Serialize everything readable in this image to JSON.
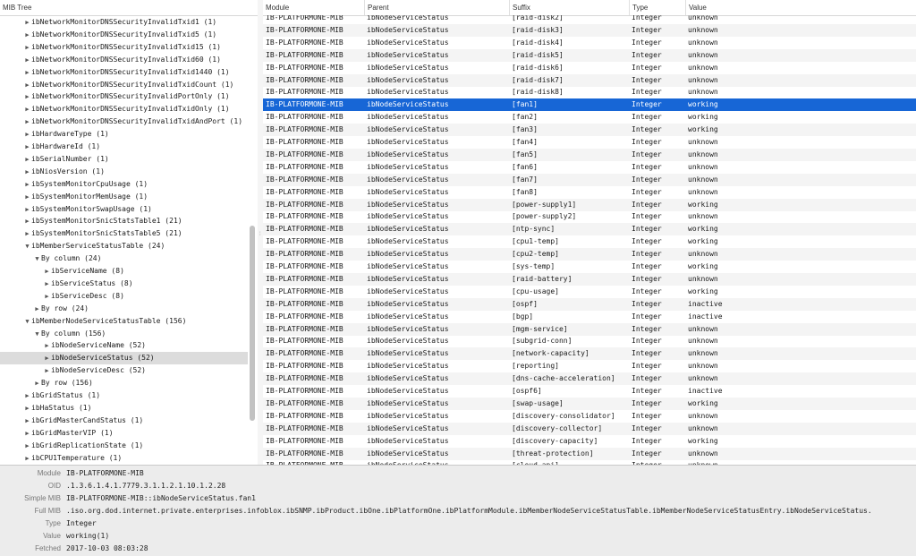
{
  "tree": {
    "header": "MIB Tree",
    "rows": [
      {
        "label": "ibNetworkMonitorDNSSecurityInvalidTxid1 (1)",
        "level": 2,
        "toggle": "collapsed"
      },
      {
        "label": "ibNetworkMonitorDNSSecurityInvalidTxid5 (1)",
        "level": 2,
        "toggle": "collapsed"
      },
      {
        "label": "ibNetworkMonitorDNSSecurityInvalidTxid15 (1)",
        "level": 2,
        "toggle": "collapsed"
      },
      {
        "label": "ibNetworkMonitorDNSSecurityInvalidTxid60 (1)",
        "level": 2,
        "toggle": "collapsed"
      },
      {
        "label": "ibNetworkMonitorDNSSecurityInvalidTxid1440 (1)",
        "level": 2,
        "toggle": "collapsed"
      },
      {
        "label": "ibNetworkMonitorDNSSecurityInvalidTxidCount (1)",
        "level": 2,
        "toggle": "collapsed"
      },
      {
        "label": "ibNetworkMonitorDNSSecurityInvalidPortOnly (1)",
        "level": 2,
        "toggle": "collapsed"
      },
      {
        "label": "ibNetworkMonitorDNSSecurityInvalidTxidOnly (1)",
        "level": 2,
        "toggle": "collapsed"
      },
      {
        "label": "ibNetworkMonitorDNSSecurityInvalidTxidAndPort (1)",
        "level": 2,
        "toggle": "collapsed"
      },
      {
        "label": "ibHardwareType (1)",
        "level": 2,
        "toggle": "collapsed"
      },
      {
        "label": "ibHardwareId (1)",
        "level": 2,
        "toggle": "collapsed"
      },
      {
        "label": "ibSerialNumber (1)",
        "level": 2,
        "toggle": "collapsed"
      },
      {
        "label": "ibNiosVersion (1)",
        "level": 2,
        "toggle": "collapsed"
      },
      {
        "label": "ibSystemMonitorCpuUsage (1)",
        "level": 2,
        "toggle": "collapsed"
      },
      {
        "label": "ibSystemMonitorMemUsage (1)",
        "level": 2,
        "toggle": "collapsed"
      },
      {
        "label": "ibSystemMonitorSwapUsage (1)",
        "level": 2,
        "toggle": "collapsed"
      },
      {
        "label": "ibSystemMonitorSnicStatsTable1 (21)",
        "level": 2,
        "toggle": "collapsed"
      },
      {
        "label": "ibSystemMonitorSnicStatsTable5 (21)",
        "level": 2,
        "toggle": "collapsed"
      },
      {
        "label": "ibMemberServiceStatusTable (24)",
        "level": 2,
        "toggle": "expanded"
      },
      {
        "label": "By column (24)",
        "level": 3,
        "toggle": "expanded"
      },
      {
        "label": "ibServiceName (8)",
        "level": 4,
        "toggle": "collapsed"
      },
      {
        "label": "ibServiceStatus (8)",
        "level": 4,
        "toggle": "collapsed"
      },
      {
        "label": "ibServiceDesc (8)",
        "level": 4,
        "toggle": "collapsed"
      },
      {
        "label": "By row (24)",
        "level": 3,
        "toggle": "collapsed"
      },
      {
        "label": "ibMemberNodeServiceStatusTable (156)",
        "level": 2,
        "toggle": "expanded"
      },
      {
        "label": "By column (156)",
        "level": 3,
        "toggle": "expanded"
      },
      {
        "label": "ibNodeServiceName (52)",
        "level": 4,
        "toggle": "collapsed"
      },
      {
        "label": "ibNodeServiceStatus (52)",
        "level": 4,
        "toggle": "collapsed",
        "selected": true
      },
      {
        "label": "ibNodeServiceDesc (52)",
        "level": 4,
        "toggle": "collapsed"
      },
      {
        "label": "By row (156)",
        "level": 3,
        "toggle": "collapsed"
      },
      {
        "label": "ibGridStatus (1)",
        "level": 2,
        "toggle": "collapsed"
      },
      {
        "label": "ibHaStatus (1)",
        "level": 2,
        "toggle": "collapsed"
      },
      {
        "label": "ibGridMasterCandStatus (1)",
        "level": 2,
        "toggle": "collapsed"
      },
      {
        "label": "ibGridMasterVIP (1)",
        "level": 2,
        "toggle": "collapsed"
      },
      {
        "label": "ibGridReplicationState (1)",
        "level": 2,
        "toggle": "collapsed"
      },
      {
        "label": "ibCPU1Temperature (1)",
        "level": 2,
        "toggle": "collapsed"
      }
    ]
  },
  "table": {
    "columns": [
      "Module",
      "Parent",
      "Suffix",
      "Type",
      "Value"
    ],
    "rows": [
      [
        "IB-PLATFORMONE-MIB",
        "ibNodeServiceStatus",
        "[raid-disk2]",
        "Integer",
        "unknown"
      ],
      [
        "IB-PLATFORMONE-MIB",
        "ibNodeServiceStatus",
        "[raid-disk3]",
        "Integer",
        "unknown"
      ],
      [
        "IB-PLATFORMONE-MIB",
        "ibNodeServiceStatus",
        "[raid-disk4]",
        "Integer",
        "unknown"
      ],
      [
        "IB-PLATFORMONE-MIB",
        "ibNodeServiceStatus",
        "[raid-disk5]",
        "Integer",
        "unknown"
      ],
      [
        "IB-PLATFORMONE-MIB",
        "ibNodeServiceStatus",
        "[raid-disk6]",
        "Integer",
        "unknown"
      ],
      [
        "IB-PLATFORMONE-MIB",
        "ibNodeServiceStatus",
        "[raid-disk7]",
        "Integer",
        "unknown"
      ],
      [
        "IB-PLATFORMONE-MIB",
        "ibNodeServiceStatus",
        "[raid-disk8]",
        "Integer",
        "unknown"
      ],
      [
        "IB-PLATFORMONE-MIB",
        "ibNodeServiceStatus",
        "[fan1]",
        "Integer",
        "working"
      ],
      [
        "IB-PLATFORMONE-MIB",
        "ibNodeServiceStatus",
        "[fan2]",
        "Integer",
        "working"
      ],
      [
        "IB-PLATFORMONE-MIB",
        "ibNodeServiceStatus",
        "[fan3]",
        "Integer",
        "working"
      ],
      [
        "IB-PLATFORMONE-MIB",
        "ibNodeServiceStatus",
        "[fan4]",
        "Integer",
        "unknown"
      ],
      [
        "IB-PLATFORMONE-MIB",
        "ibNodeServiceStatus",
        "[fan5]",
        "Integer",
        "unknown"
      ],
      [
        "IB-PLATFORMONE-MIB",
        "ibNodeServiceStatus",
        "[fan6]",
        "Integer",
        "unknown"
      ],
      [
        "IB-PLATFORMONE-MIB",
        "ibNodeServiceStatus",
        "[fan7]",
        "Integer",
        "unknown"
      ],
      [
        "IB-PLATFORMONE-MIB",
        "ibNodeServiceStatus",
        "[fan8]",
        "Integer",
        "unknown"
      ],
      [
        "IB-PLATFORMONE-MIB",
        "ibNodeServiceStatus",
        "[power-supply1]",
        "Integer",
        "working"
      ],
      [
        "IB-PLATFORMONE-MIB",
        "ibNodeServiceStatus",
        "[power-supply2]",
        "Integer",
        "unknown"
      ],
      [
        "IB-PLATFORMONE-MIB",
        "ibNodeServiceStatus",
        "[ntp-sync]",
        "Integer",
        "working"
      ],
      [
        "IB-PLATFORMONE-MIB",
        "ibNodeServiceStatus",
        "[cpu1-temp]",
        "Integer",
        "working"
      ],
      [
        "IB-PLATFORMONE-MIB",
        "ibNodeServiceStatus",
        "[cpu2-temp]",
        "Integer",
        "unknown"
      ],
      [
        "IB-PLATFORMONE-MIB",
        "ibNodeServiceStatus",
        "[sys-temp]",
        "Integer",
        "working"
      ],
      [
        "IB-PLATFORMONE-MIB",
        "ibNodeServiceStatus",
        "[raid-battery]",
        "Integer",
        "unknown"
      ],
      [
        "IB-PLATFORMONE-MIB",
        "ibNodeServiceStatus",
        "[cpu-usage]",
        "Integer",
        "working"
      ],
      [
        "IB-PLATFORMONE-MIB",
        "ibNodeServiceStatus",
        "[ospf]",
        "Integer",
        "inactive"
      ],
      [
        "IB-PLATFORMONE-MIB",
        "ibNodeServiceStatus",
        "[bgp]",
        "Integer",
        "inactive"
      ],
      [
        "IB-PLATFORMONE-MIB",
        "ibNodeServiceStatus",
        "[mgm-service]",
        "Integer",
        "unknown"
      ],
      [
        "IB-PLATFORMONE-MIB",
        "ibNodeServiceStatus",
        "[subgrid-conn]",
        "Integer",
        "unknown"
      ],
      [
        "IB-PLATFORMONE-MIB",
        "ibNodeServiceStatus",
        "[network-capacity]",
        "Integer",
        "unknown"
      ],
      [
        "IB-PLATFORMONE-MIB",
        "ibNodeServiceStatus",
        "[reporting]",
        "Integer",
        "unknown"
      ],
      [
        "IB-PLATFORMONE-MIB",
        "ibNodeServiceStatus",
        "[dns-cache-acceleration]",
        "Integer",
        "unknown"
      ],
      [
        "IB-PLATFORMONE-MIB",
        "ibNodeServiceStatus",
        "[ospf6]",
        "Integer",
        "inactive"
      ],
      [
        "IB-PLATFORMONE-MIB",
        "ibNodeServiceStatus",
        "[swap-usage]",
        "Integer",
        "working"
      ],
      [
        "IB-PLATFORMONE-MIB",
        "ibNodeServiceStatus",
        "[discovery-consolidator]",
        "Integer",
        "unknown"
      ],
      [
        "IB-PLATFORMONE-MIB",
        "ibNodeServiceStatus",
        "[discovery-collector]",
        "Integer",
        "unknown"
      ],
      [
        "IB-PLATFORMONE-MIB",
        "ibNodeServiceStatus",
        "[discovery-capacity]",
        "Integer",
        "working"
      ],
      [
        "IB-PLATFORMONE-MIB",
        "ibNodeServiceStatus",
        "[threat-protection]",
        "Integer",
        "unknown"
      ],
      [
        "IB-PLATFORMONE-MIB",
        "ibNodeServiceStatus",
        "[cloud-api]",
        "Integer",
        "unknown"
      ]
    ],
    "selected_index": 7
  },
  "details": {
    "rows": [
      {
        "label": "Module",
        "value": "IB-PLATFORMONE-MIB"
      },
      {
        "label": "OID",
        "value": ".1.3.6.1.4.1.7779.3.1.1.2.1.10.1.2.28"
      },
      {
        "label": "Simple MIB",
        "value": "IB-PLATFORMONE-MIB::ibNodeServiceStatus.fan1"
      },
      {
        "label": "Full MIB",
        "value": ".iso.org.dod.internet.private.enterprises.infoblox.ibSNMP.ibProduct.ibOne.ibPlatformOne.ibPlatformModule.ibMemberNodeServiceStatusTable.ibMemberNodeServiceStatusEntry.ibNodeServiceStatus."
      },
      {
        "label": "Type",
        "value": "Integer"
      },
      {
        "label": "Value",
        "value": "working(1)"
      },
      {
        "label": "Fetched",
        "value": "2017-10-03 08:03:28"
      }
    ]
  },
  "colors": {
    "selection": "#1766d6",
    "tree_selection": "#dcdcdc",
    "details_bg": "#ececec"
  }
}
